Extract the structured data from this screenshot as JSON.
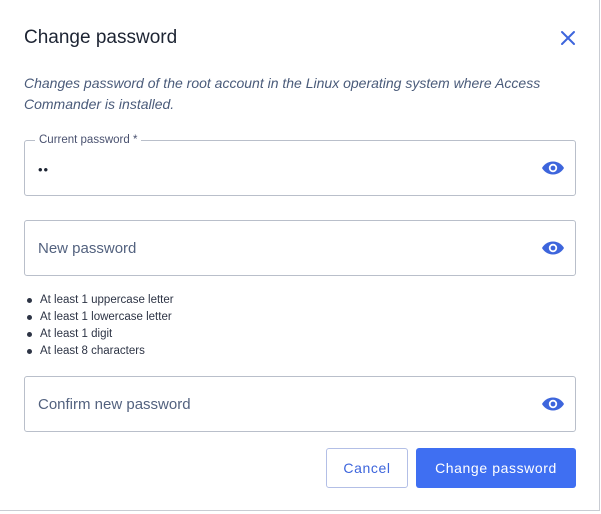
{
  "dialog": {
    "title": "Change password",
    "description": "Changes password of the root account in the Linux operating system where Access Commander is installed."
  },
  "fields": {
    "current": {
      "label": "Current password *",
      "value": "••"
    },
    "new": {
      "placeholder": "New password"
    },
    "confirm": {
      "placeholder": "Confirm new password"
    }
  },
  "rules": [
    "At least 1 uppercase letter",
    "At least 1 lowercase letter",
    "At least 1 digit",
    "At least 8 characters"
  ],
  "buttons": {
    "cancel": "Cancel",
    "submit": "Change password"
  },
  "colors": {
    "accent": "#3f6ff2",
    "icon": "#3d65dc"
  },
  "icons": {
    "close": "close-icon",
    "toggle_visibility": "eye-icon"
  }
}
